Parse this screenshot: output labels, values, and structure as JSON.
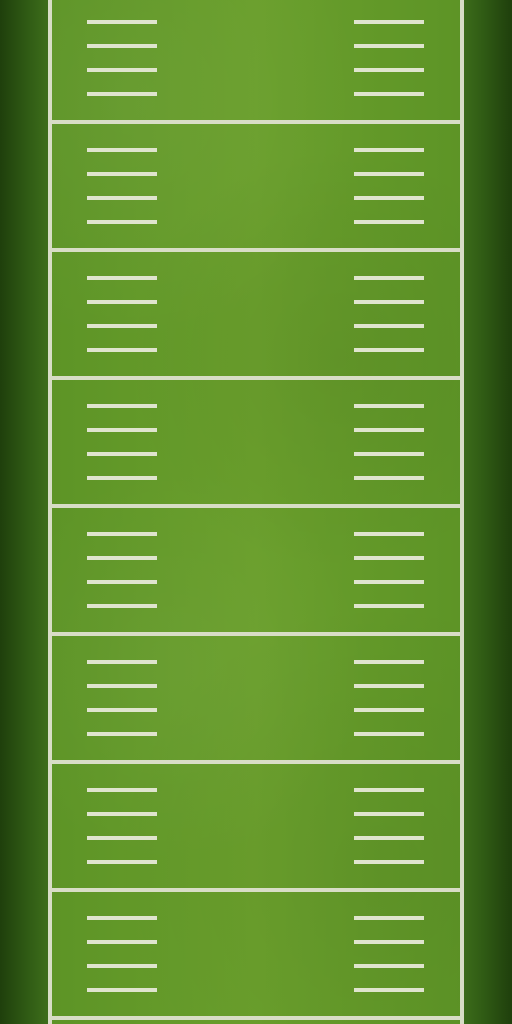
{
  "field": {
    "surface": "football-field",
    "grass_color": "#6a9f2c",
    "line_color": "#d8ddc6",
    "yard_line_count": 8,
    "hash_marks_per_segment_each_side": 4
  }
}
